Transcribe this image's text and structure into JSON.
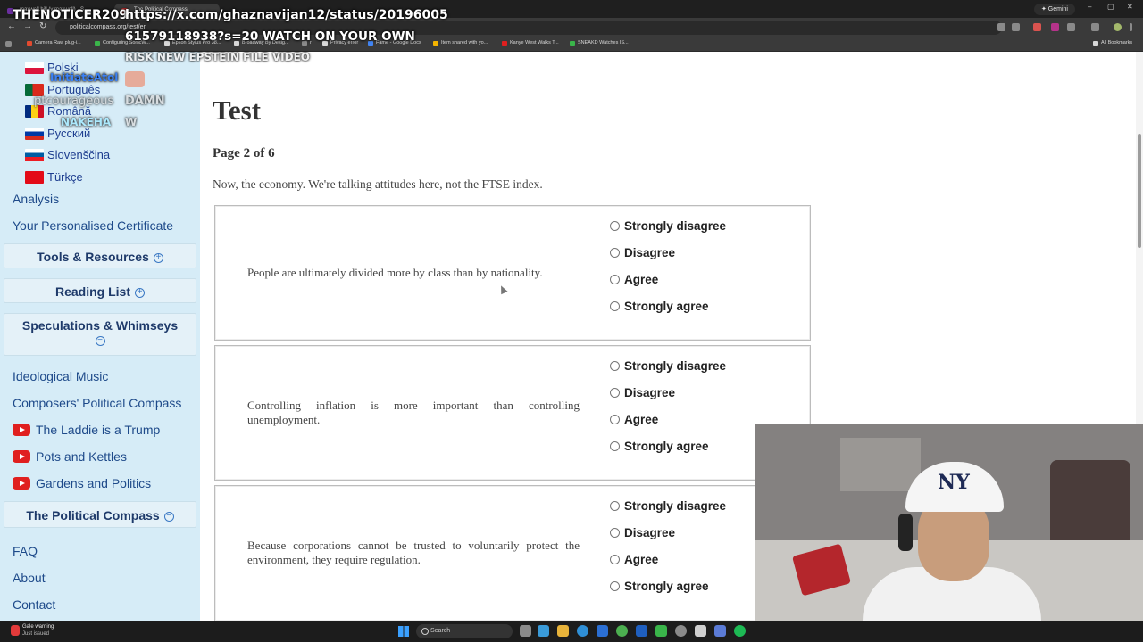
{
  "browser": {
    "tabs": [
      {
        "title": "maxwell.hill (y/maxwell) - S"
      },
      {
        "title": "The Political Compass"
      }
    ],
    "gemini_label": "✦ Gemini",
    "url": "politicalcompass.org/test/en",
    "bookmarks": [
      {
        "label": "Camera Raw plug-i...",
        "color": "#e34a2f"
      },
      {
        "label": "Configuring SonicW...",
        "color": "#3ab54a"
      },
      {
        "label": "Epson Stylus Pro 38...",
        "color": "#d8d8d8"
      },
      {
        "label": "Broadway By Desig...",
        "color": "#d8d8d8"
      },
      {
        "label": "r",
        "color": "#8a8a8a"
      },
      {
        "label": "Privacy error",
        "color": "#d8d8d8"
      },
      {
        "label": "Fame - Google Docs",
        "color": "#4285f4"
      },
      {
        "label": "Item shared with yo...",
        "color": "#f4b400"
      },
      {
        "label": "Kanye West Walks T...",
        "color": "#e01f1f"
      },
      {
        "label": "SNEAKD Watches IS...",
        "color": "#3ab54a"
      }
    ],
    "all_bookmarks": "All Bookmarks"
  },
  "overlay": {
    "username": "THENOTICER209",
    "url_line1": "https://x.com/ghaznavijan12/status/20196005",
    "url_line2": "61579118938?s=20 WATCH ON YOUR OWN",
    "line3": "RISK NEW EPSTEIN FILE VIDEO",
    "initiate": "InitiateAtol",
    "courageous": "ptcourageous",
    "damn": "DAMN",
    "nakeha": "NAKEHA",
    "w": "W"
  },
  "sidebar": {
    "languages": [
      {
        "label": "Polski"
      },
      {
        "label": "Português"
      },
      {
        "label": "Română"
      },
      {
        "label": "Русский"
      },
      {
        "label": "Slovenščina"
      },
      {
        "label": "Türkçe"
      }
    ],
    "analysis": "Analysis",
    "certificate": "Your Personalised Certificate",
    "tools": "Tools & Resources",
    "reading": "Reading List",
    "speculations": "Speculations & Whimseys",
    "music": "Ideological Music",
    "composers": "Composers' Political Compass",
    "videos": [
      {
        "label": "The Laddie is a Trump"
      },
      {
        "label": "Pots and Kettles"
      },
      {
        "label": "Gardens and Politics"
      }
    ],
    "compass": "The Political Compass",
    "faq": "FAQ",
    "about": "About",
    "contact": "Contact"
  },
  "main": {
    "title": "Test",
    "page": "Page 2 of 6",
    "intro": "Now, the economy. We're talking attitudes here, not the FTSE index.",
    "options": [
      "Strongly disagree",
      "Disagree",
      "Agree",
      "Strongly agree"
    ],
    "questions": [
      {
        "text": "People are ultimately divided more by class than by nationality."
      },
      {
        "text": "Controlling inflation is more important than controlling unemployment."
      },
      {
        "text": "Because corporations cannot be trusted to voluntarily protect the environment, they require regulation."
      }
    ]
  },
  "taskbar": {
    "notification_title": "Gale warning",
    "notification_sub": "Just issued",
    "search": "Search"
  }
}
